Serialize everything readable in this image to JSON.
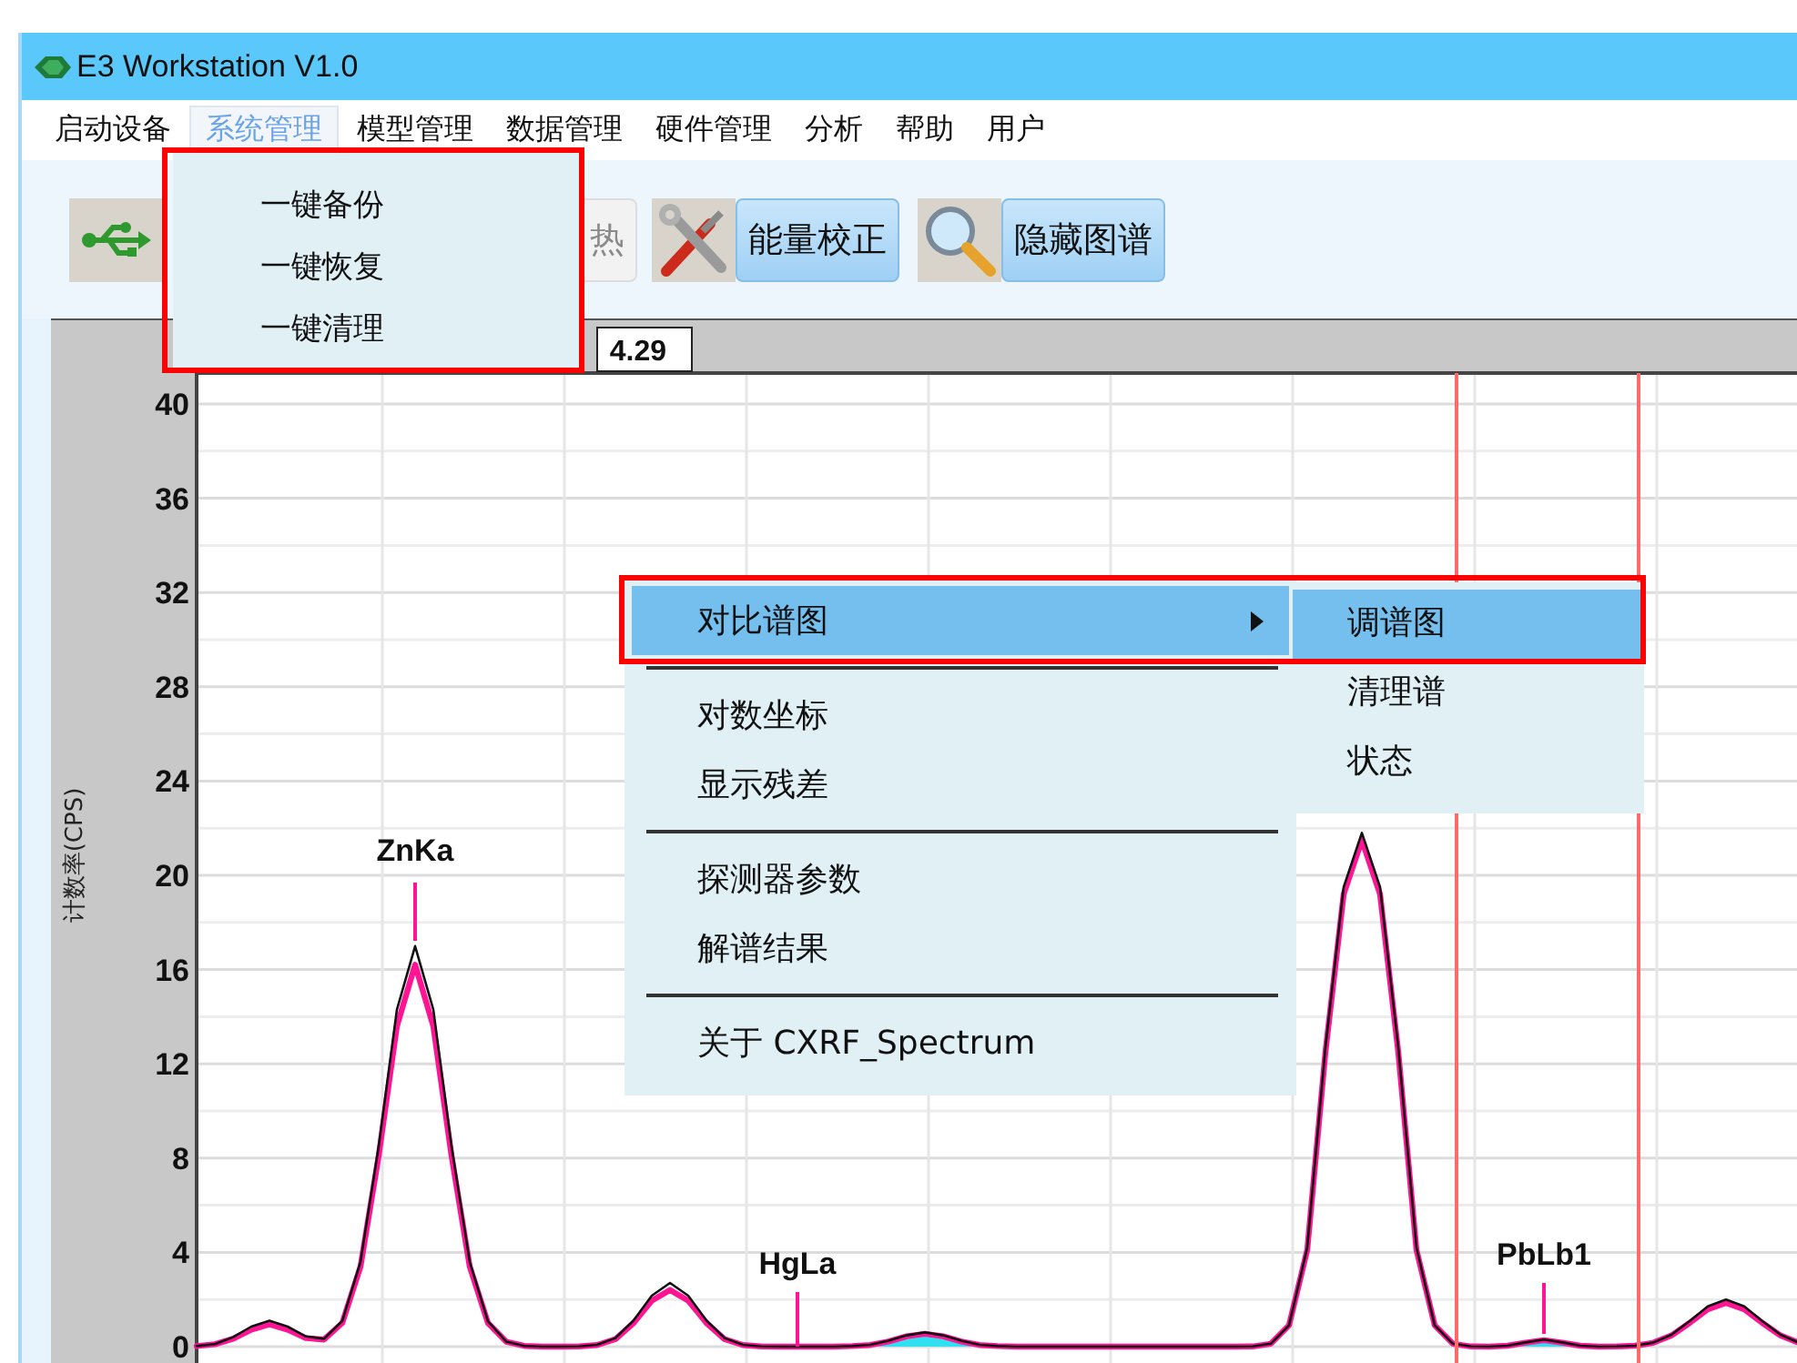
{
  "window": {
    "title": "E3 Workstation V1.0"
  },
  "menu_bar": [
    {
      "label": "启动设备",
      "selected": false
    },
    {
      "label": "系统管理",
      "selected": true
    },
    {
      "label": "模型管理",
      "selected": false
    },
    {
      "label": "数据管理",
      "selected": false
    },
    {
      "label": "硬件管理",
      "selected": false
    },
    {
      "label": "分析",
      "selected": false
    },
    {
      "label": "帮助",
      "selected": false
    },
    {
      "label": "用户",
      "selected": false
    }
  ],
  "system_menu": {
    "items": [
      "一键备份",
      "一键恢复",
      "一键清理"
    ]
  },
  "toolbar": [
    {
      "kind": "icon"
    },
    {
      "kind": "button",
      "label": "热",
      "disabled": true
    },
    {
      "kind": "icon"
    },
    {
      "kind": "button",
      "label": "能量校正",
      "disabled": false
    },
    {
      "kind": "icon"
    },
    {
      "kind": "button",
      "label": "隐藏图谱",
      "disabled": false
    }
  ],
  "chart": {
    "readout": "4.29",
    "peaks": [
      {
        "label": "ZnKa"
      },
      {
        "label": "HgLa"
      },
      {
        "label": "PbLb1"
      }
    ],
    "chart_data": {
      "type": "line",
      "ylabel": "计数率(CPS)",
      "grid": true,
      "ylim": [
        0,
        40
      ],
      "yticks": [
        0,
        4,
        8,
        12,
        16,
        20,
        24,
        28,
        32,
        36,
        40
      ],
      "categories": [
        null,
        null,
        null,
        null,
        null,
        null,
        null,
        null,
        null,
        null,
        null,
        null,
        null,
        null,
        null,
        null,
        null,
        null,
        null,
        null,
        null,
        null,
        null,
        null,
        null,
        null,
        null,
        null,
        null,
        null,
        null,
        null,
        null,
        null,
        null,
        null,
        null,
        null,
        null,
        null,
        null,
        null,
        null,
        null,
        null,
        null,
        null,
        null,
        null,
        null,
        null,
        null,
        null,
        null,
        null,
        null,
        null,
        null,
        null,
        null,
        null,
        null,
        null,
        null,
        null,
        null,
        null,
        null,
        null,
        null,
        null,
        null,
        null,
        null,
        null,
        null,
        null,
        null,
        null,
        null,
        null,
        null,
        null,
        null,
        null,
        null,
        null,
        null,
        null
      ],
      "series": [
        {
          "color": "#111111",
          "values": [
            0.02,
            0.11,
            0.4,
            0.85,
            1.1,
            0.85,
            0.43,
            0.33,
            1.09,
            3.6,
            8.5,
            14.3,
            17,
            14.3,
            8.5,
            3.6,
            1.07,
            0.22,
            0.03,
            0,
            0,
            0.01,
            0.08,
            0.36,
            1.11,
            2.16,
            2.7,
            2.16,
            1.11,
            0.36,
            0.08,
            0.01,
            0,
            0,
            0,
            0,
            0.02,
            0.08,
            0.25,
            0.48,
            0.6,
            0.48,
            0.25,
            0.08,
            0.02,
            0,
            0,
            0,
            0,
            0,
            0,
            0,
            0,
            0,
            0,
            0,
            0,
            0,
            0.01,
            0.12,
            0.9,
            4.2,
            12.7,
            19.5,
            21.8,
            19.5,
            12.7,
            4.2,
            0.9,
            0.12,
            0.01,
            0,
            0.04,
            0.18,
            0.3,
            0.18,
            0.04,
            0,
            0.01,
            0.04,
            0.17,
            0.5,
            1.08,
            1.71,
            2,
            1.71,
            1.08,
            0.5,
            0.17
          ]
        },
        {
          "color": "#ff1493",
          "values": [
            0.02,
            0.1,
            0.33,
            0.72,
            0.95,
            0.72,
            0.36,
            0.3,
            1.0,
            3.4,
            8.1,
            13.6,
            16.2,
            13.6,
            8.1,
            3.4,
            1.0,
            0.21,
            0.03,
            0,
            0,
            0.01,
            0.07,
            0.32,
            1.0,
            1.95,
            2.4,
            1.95,
            1.0,
            0.32,
            0.07,
            0.01,
            0,
            0,
            0,
            0,
            0.02,
            0.07,
            0.22,
            0.44,
            0.55,
            0.44,
            0.22,
            0.07,
            0.02,
            0,
            0,
            0,
            0,
            0,
            0,
            0,
            0,
            0,
            0,
            0,
            0,
            0,
            0.01,
            0.12,
            0.9,
            4.1,
            12.5,
            19.2,
            21.5,
            19.2,
            12.5,
            4.1,
            0.9,
            0.12,
            0.01,
            0,
            0.04,
            0.17,
            0.28,
            0.17,
            0.04,
            0,
            0.01,
            0.04,
            0.16,
            0.47,
            1.0,
            1.58,
            1.85,
            1.58,
            1.0,
            0.47,
            0.16
          ]
        }
      ]
    }
  },
  "context_menu": {
    "items": [
      {
        "kind": "item",
        "label": "对比谱图",
        "submenu": true,
        "selected": true
      },
      {
        "kind": "separator"
      },
      {
        "kind": "item",
        "label": "对数坐标",
        "submenu": false,
        "selected": false
      },
      {
        "kind": "item",
        "label": "显示残差",
        "submenu": false,
        "selected": false
      },
      {
        "kind": "separator"
      },
      {
        "kind": "item",
        "label": "探测器参数",
        "submenu": false,
        "selected": false
      },
      {
        "kind": "item",
        "label": "解谱结果",
        "submenu": false,
        "selected": false
      },
      {
        "kind": "separator"
      },
      {
        "kind": "item",
        "label": "关于 CXRF_Spectrum",
        "submenu": false,
        "selected": false
      }
    ]
  },
  "submenu": {
    "items": [
      {
        "label": "调谱图",
        "selected": true
      },
      {
        "label": "清理谱",
        "selected": false
      },
      {
        "label": "状态",
        "selected": false
      }
    ]
  }
}
